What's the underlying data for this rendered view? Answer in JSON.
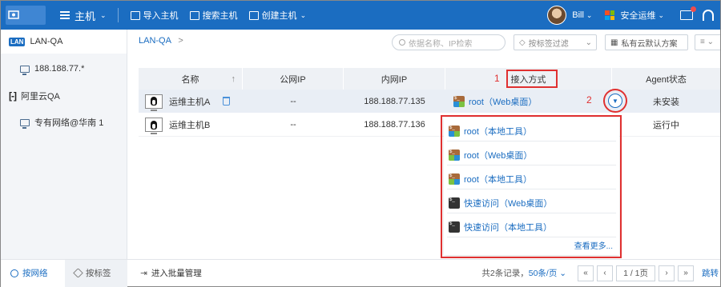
{
  "topbar": {
    "menu_label": "主机",
    "items": [
      {
        "label": "导入主机"
      },
      {
        "label": "搜索主机"
      },
      {
        "label": "创建主机"
      }
    ],
    "user_name": "Bill",
    "ops_label": "安全运维"
  },
  "sidebar": {
    "items": [
      {
        "label": "LAN-QA",
        "badge": "LAN"
      },
      {
        "label": "188.188.77.*"
      },
      {
        "label": "阿里云QA"
      },
      {
        "label": "专有网络@华南 1"
      }
    ]
  },
  "breadcrumb": {
    "label": "LAN-QA",
    "sep": ">"
  },
  "toolbar": {
    "search_placeholder": "依据名称、IP检索",
    "tag_filter": "按标签过滤",
    "scheme": "私有云默认方案"
  },
  "table": {
    "columns": [
      "名称",
      "公网IP",
      "内网IP",
      "接入方式",
      "Agent状态"
    ],
    "sort_arrow": "↑",
    "rows": [
      {
        "name": "运维主机A",
        "public_ip": "--",
        "private_ip": "188.188.77.135",
        "access": "root（Web桌面）",
        "agent": "未安装"
      },
      {
        "name": "运维主机B",
        "public_ip": "--",
        "private_ip": "188.188.77.136",
        "access": "",
        "agent": "运行中"
      }
    ]
  },
  "annotations": {
    "one": "1",
    "two": "2"
  },
  "dropdown": {
    "items": [
      {
        "label": "root（本地工具）",
        "icon": "ssh-icon"
      },
      {
        "label": "root（Web桌面）",
        "icon": "ssh-icon"
      },
      {
        "label": "root（本地工具）",
        "icon": "ssh-icon"
      },
      {
        "label": "快速访问（Web桌面）",
        "icon": "terminal-icon"
      },
      {
        "label": "快速访问（本地工具）",
        "icon": "terminal-icon"
      }
    ],
    "more": "查看更多..."
  },
  "footer": {
    "tab_network": "按网络",
    "tab_tag": "按标签",
    "batch": "进入批量管理",
    "records": "共2条记录，",
    "per_page": "50条/页",
    "page": "1 / 1页",
    "jump": "跳转"
  },
  "colors": {
    "brand": "#1b6dc1",
    "annotation": "#e03030"
  }
}
